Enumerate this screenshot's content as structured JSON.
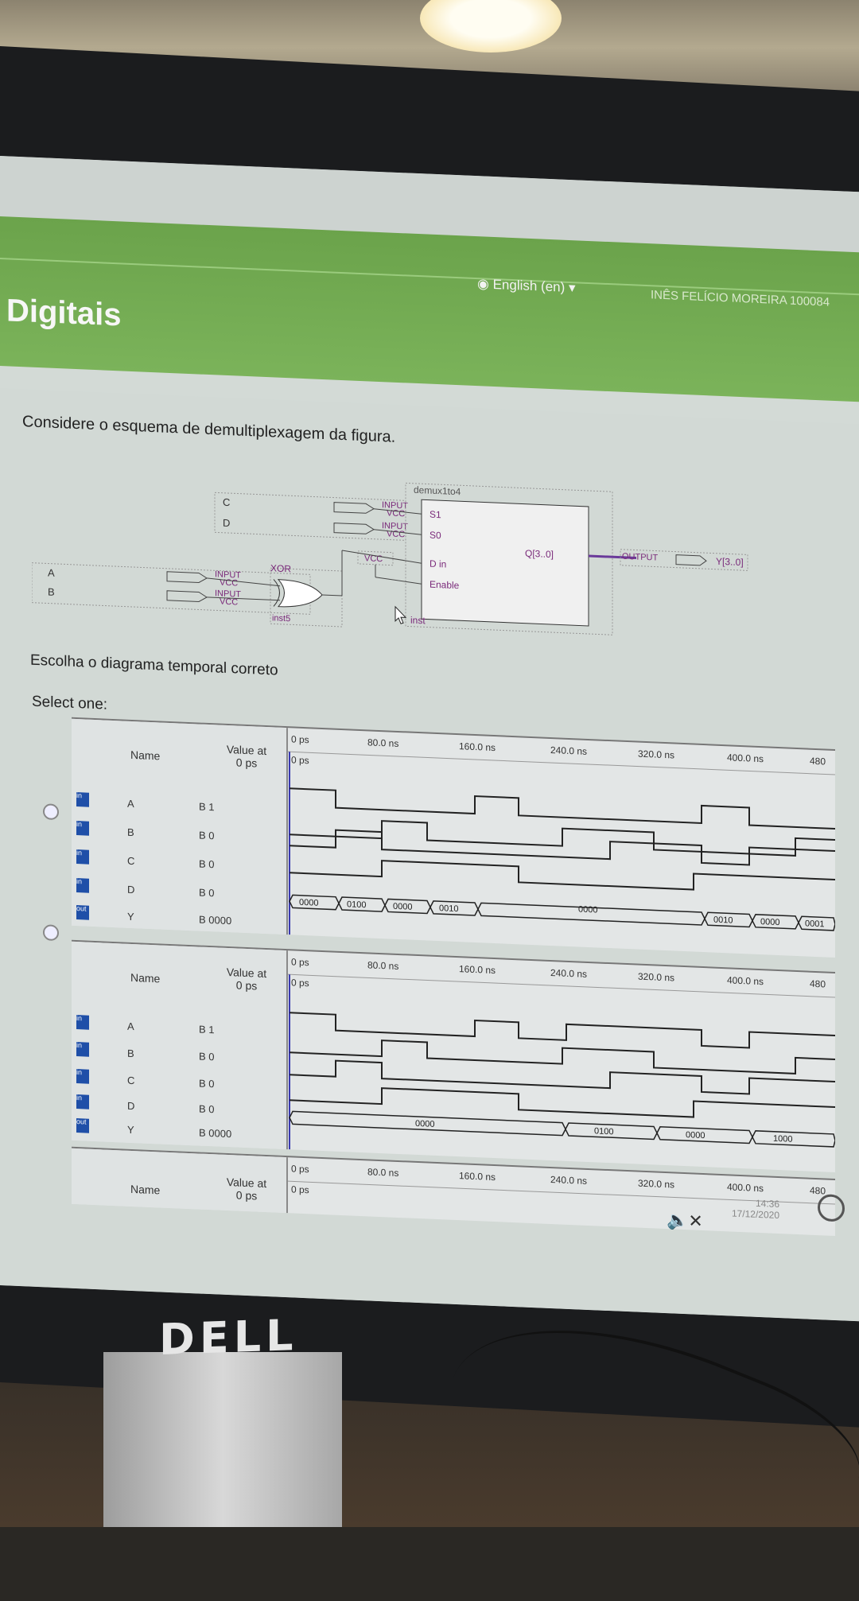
{
  "header": {
    "site_title": "Digitais",
    "language": "English (en)",
    "user_name": "INÊS FELÍCIO MOREIRA 100084"
  },
  "question": {
    "prompt": "Considere o esquema de demultiplexagem da figura.",
    "instruction": "Escolha o diagrama temporal correto",
    "select_label": "Select one:"
  },
  "schematic": {
    "block_name": "demux1to4",
    "inst_label": "inst",
    "xor_label": "XOR",
    "xor_inst": "inst5",
    "input_word": "INPUT",
    "vcc_word": "VCC",
    "output_word": "OUTPUT",
    "pins": {
      "s1": "S1",
      "s0": "S0",
      "din": "D in",
      "enable": "Enable",
      "q": "Q[3..0]"
    },
    "inputs": [
      "C",
      "D",
      "A",
      "B"
    ],
    "output_name": "Y[3..0]"
  },
  "waveforms": {
    "col_name": "Name",
    "col_value": "Value at",
    "col_value_sub": "0 ps",
    "time_ticks": [
      "0 ps",
      "80.0 ns",
      "160.0 ns",
      "240.0 ns",
      "320.0 ns",
      "400.0 ns",
      "480"
    ],
    "cursor_label": "0 ps",
    "option1": {
      "rows": [
        {
          "name": "A",
          "value": "B 1",
          "dir": "in"
        },
        {
          "name": "B",
          "value": "B 0",
          "dir": "in"
        },
        {
          "name": "C",
          "value": "B 0",
          "dir": "in"
        },
        {
          "name": "D",
          "value": "B 0",
          "dir": "in"
        },
        {
          "name": "Y",
          "value": "B 0000",
          "dir": "out"
        }
      ],
      "bus_labels": [
        "0000",
        "0100",
        "0000",
        "0010",
        "0000",
        "0010",
        "0000",
        "0001"
      ]
    },
    "option2": {
      "rows": [
        {
          "name": "A",
          "value": "B 1",
          "dir": "in"
        },
        {
          "name": "B",
          "value": "B 0",
          "dir": "in"
        },
        {
          "name": "C",
          "value": "B 0",
          "dir": "in"
        },
        {
          "name": "D",
          "value": "B 0",
          "dir": "in"
        },
        {
          "name": "Y",
          "value": "B 0000",
          "dir": "out"
        }
      ],
      "bus_labels": [
        "0000",
        "0100",
        "0000",
        "1000"
      ]
    },
    "option3": {
      "time_ticks": [
        "0 ps",
        "80.0 ns",
        "160.0 ns",
        "240.0 ns",
        "320.0 ns",
        "400.0 ns",
        "480"
      ],
      "cursor_label": "0 ps"
    }
  },
  "taskbar": {
    "time": "14:36",
    "date": "17/12/2020"
  },
  "monitor": {
    "brand": "DELL"
  }
}
